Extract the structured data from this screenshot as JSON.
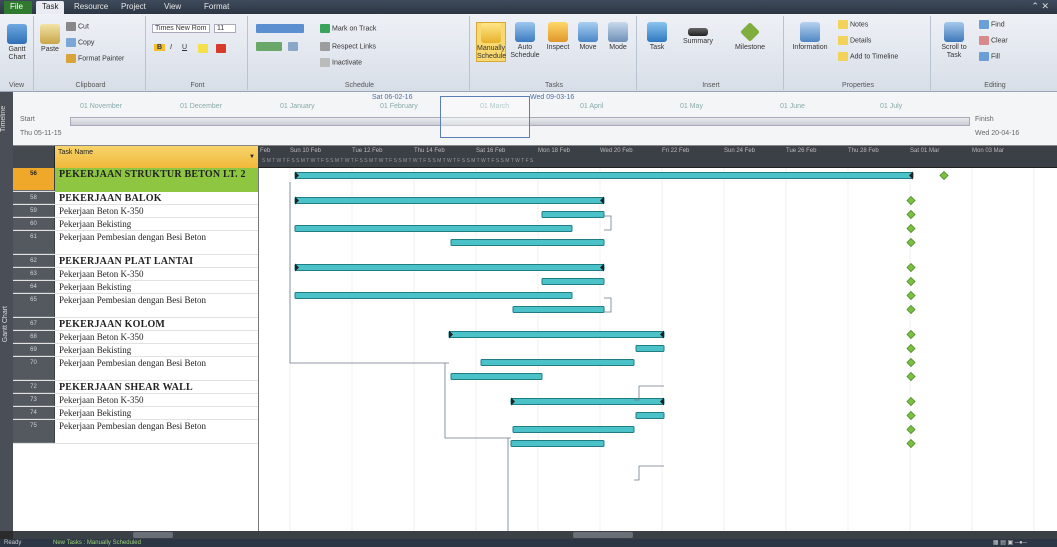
{
  "ribbon_tabs": [
    "File",
    "Task",
    "Resource",
    "Project",
    "View",
    "Format"
  ],
  "active_tab": "Task",
  "ribbon": {
    "view": {
      "gantt_chart": "Gantt Chart",
      "label": "View"
    },
    "clipboard": {
      "paste": "Paste",
      "cut": "Cut",
      "copy": "Copy",
      "format_painter": "Format Painter",
      "label": "Clipboard"
    },
    "font": {
      "font_name": "Times New Rom",
      "font_size": "11",
      "bold": "B",
      "italic": "I",
      "underline": "U",
      "label": "Font"
    },
    "schedule": {
      "mark_on_track": "Mark on Track",
      "respect_links": "Respect Links",
      "inactivate": "Inactivate",
      "label": "Schedule"
    },
    "tasks": {
      "manually_schedule": "Manually Schedule",
      "auto_schedule": "Auto Schedule",
      "inspect": "Inspect",
      "move": "Move",
      "mode": "Mode",
      "label": "Tasks"
    },
    "insert": {
      "task": "Task",
      "summary": "Summary",
      "milestone": "Milestone",
      "label": "Insert"
    },
    "properties": {
      "information": "Information",
      "notes": "Notes",
      "details": "Details",
      "add_to_timeline": "Add to Timeline",
      "label": "Properties"
    },
    "editing": {
      "scroll_to_task": "Scroll to Task",
      "find": "Find",
      "clear": "Clear",
      "fill": "Fill",
      "label": "Editing"
    }
  },
  "timeline": {
    "side_label": "Timeline",
    "start_label": "Start",
    "start_date": "Thu 05-11-15",
    "finish_label": "Finish",
    "finish_date": "Wed 20-04-16",
    "today_start": "Sat 06-02-16",
    "today_end": "Wed 09-03-16",
    "scale_labels": [
      "01 November",
      "01 December",
      "01 January",
      "01 February",
      "01 March",
      "01 April",
      "01 May",
      "01 June",
      "01 July"
    ]
  },
  "gantt": {
    "side_label": "Gantt Chart",
    "column_task_name": "Task Name",
    "date_headers": [
      "Feb",
      "Sun 10 Feb",
      "Tue 12 Feb",
      "Thu 14 Feb",
      "Sat 16 Feb",
      "Mon 18 Feb",
      "Wed 20 Feb",
      "Fri 22 Feb",
      "Sun 24 Feb",
      "Tue 26 Feb",
      "Thu 28 Feb",
      "Sat 01 Mar",
      "Mon 03 Mar"
    ],
    "day_letters": "S M T W T F S S M T W T F S S M T W T F S S M T W T F S S M T W T F S S M T W T F S S M T W T F S S M T W T F S",
    "rows": [
      {
        "id": "56",
        "name": "PEKERJAAN STRUKTUR BETON LT. 2",
        "summary": true,
        "highlight": true,
        "two_line": true
      },
      {
        "id": "58",
        "name": "PEKERJAAN BALOK",
        "summary": true
      },
      {
        "id": "59",
        "name": "Pekerjaan Beton K-350"
      },
      {
        "id": "60",
        "name": "Pekerjaan Bekisting"
      },
      {
        "id": "61",
        "name": "Pekerjaan Pembesian dengan Besi Beton",
        "two_line": true
      },
      {
        "id": "62",
        "name": "PEKERJAAN PLAT LANTAI",
        "summary": true
      },
      {
        "id": "63",
        "name": "Pekerjaan Beton K-350"
      },
      {
        "id": "64",
        "name": "Pekerjaan Bekisting"
      },
      {
        "id": "65",
        "name": "Pekerjaan Pembesian dengan Besi Beton",
        "two_line": true
      },
      {
        "id": "67",
        "name": "PEKERJAAN KOLOM",
        "summary": true
      },
      {
        "id": "68",
        "name": "Pekerjaan Beton K-350"
      },
      {
        "id": "69",
        "name": "Pekerjaan Bekisting"
      },
      {
        "id": "70",
        "name": "Pekerjaan Pembesian dengan Besi Beton",
        "two_line": true
      },
      {
        "id": "72",
        "name": "PEKERJAAN SHEAR WALL",
        "summary": true
      },
      {
        "id": "73",
        "name": "Pekerjaan Beton K-350"
      },
      {
        "id": "74",
        "name": "Pekerjaan Bekisting"
      },
      {
        "id": "75",
        "name": "Pekerjaan Pembesian dengan Besi Beton",
        "two_line": true
      }
    ]
  },
  "status": {
    "ready": "Ready",
    "new_tasks": "New Tasks : Manually Scheduled"
  },
  "colors": {
    "bar_fill": "#4bc2c8",
    "bar_dark": "#1f7d86",
    "milestone": "#7ac143",
    "highlight_row": "#8ec641",
    "id_highlight": "#f0a82a"
  }
}
